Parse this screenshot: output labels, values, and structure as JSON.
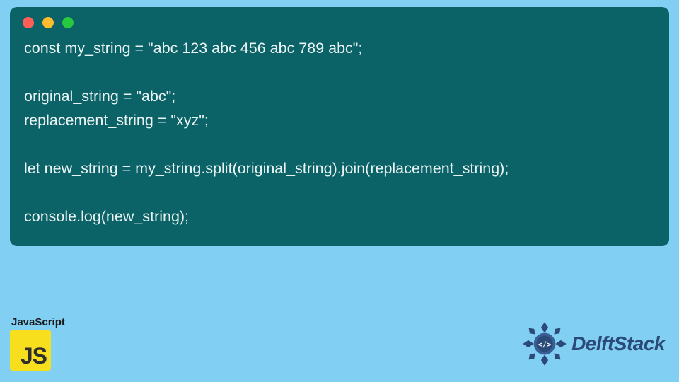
{
  "code": {
    "line1": "const my_string = \"abc 123 abc 456 abc 789 abc\";",
    "line2": "",
    "line3": "original_string = \"abc\";",
    "line4": "replacement_string = \"xyz\";",
    "line5": "",
    "line6": "let new_string = my_string.split(original_string).join(replacement_string);",
    "line7": "",
    "line8": "console.log(new_string);"
  },
  "footer": {
    "language_label": "JavaScript",
    "js_badge_text": "JS",
    "brand": "DelftStack"
  },
  "colors": {
    "page_bg": "#82cff4",
    "code_bg": "#0b6267",
    "js_yellow": "#f7df1e",
    "brand_blue": "#2b4a78"
  }
}
